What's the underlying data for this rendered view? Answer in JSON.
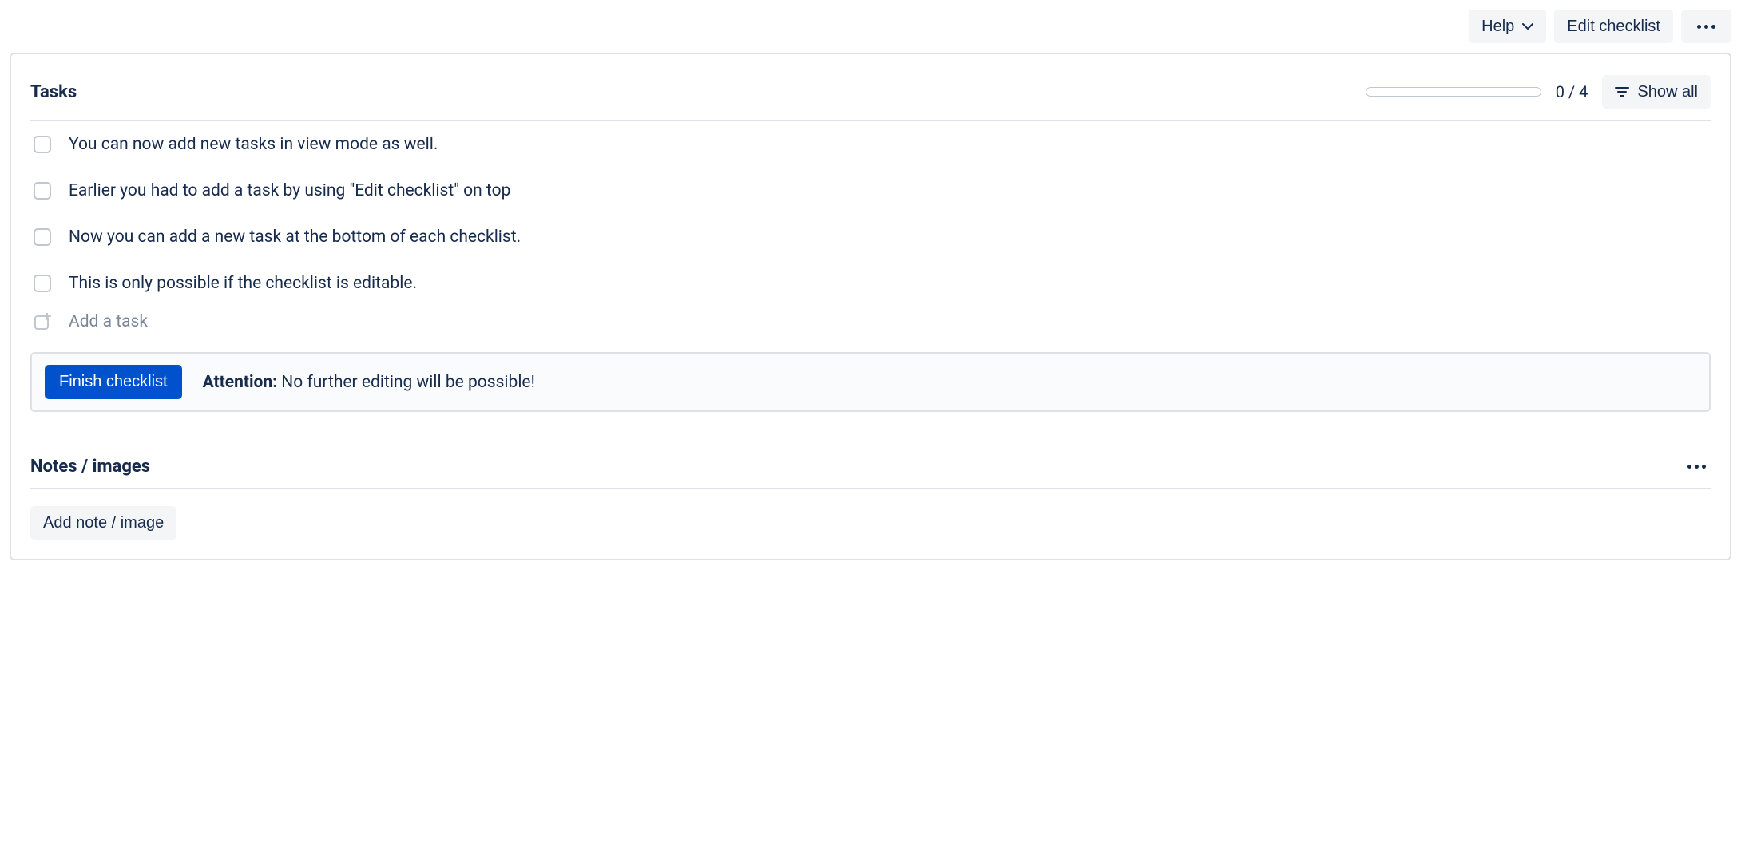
{
  "toolbar": {
    "help_label": "Help",
    "edit_label": "Edit checklist"
  },
  "tasks_section": {
    "title": "Tasks",
    "progress_text": "0 / 4",
    "show_all_label": "Show all",
    "items": [
      {
        "text": "You can now add new tasks in view mode as well."
      },
      {
        "text": "Earlier you had to add a task by using \"Edit checklist\" on top"
      },
      {
        "text": "Now you can add a new task at the bottom of each checklist."
      },
      {
        "text": "This is only possible if the checklist is editable."
      }
    ],
    "add_task_placeholder": "Add a task"
  },
  "finish_banner": {
    "button_label": "Finish checklist",
    "attention_label": "Attention:",
    "message": "No further editing will be possible!"
  },
  "notes_section": {
    "title": "Notes / images",
    "add_label": "Add note / image"
  }
}
